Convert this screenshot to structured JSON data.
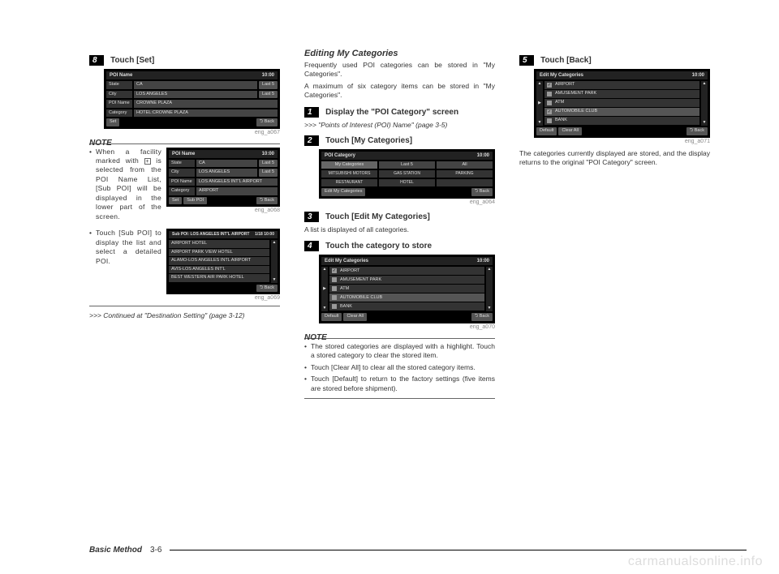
{
  "col1": {
    "step8": {
      "num": "8",
      "title": "Touch [Set]"
    },
    "screen1": {
      "title": "POI Name",
      "time": "10:00",
      "rows": [
        {
          "label": "State",
          "value": "CA",
          "btn": "Last 5"
        },
        {
          "label": "City",
          "value": "LOS ANGELES",
          "btn": "Last 5"
        },
        {
          "label": "POI Name",
          "value": "CROWNE PLAZA",
          "btn": ""
        },
        {
          "label": "Category",
          "value": "HOTEL:CROWNE PLAZA",
          "btn": ""
        }
      ],
      "set": "Set",
      "back": "Back",
      "caption": "eng_a067"
    },
    "note_label": "NOTE",
    "note1": {
      "text": "When a facility marked with       is selected from the POI Name List, [Sub POI] will be displayed in the lower part of the screen.",
      "plus": "+",
      "screen": {
        "title": "POI Name",
        "time": "10:00",
        "rows": [
          {
            "label": "State",
            "value": "CA",
            "btn": "Last 5"
          },
          {
            "label": "City",
            "value": "LOS ANGELES",
            "btn": "Last 5"
          },
          {
            "label": "POI Name",
            "value": "LOS ANGELES INT'L AIRPORT",
            "btn": ""
          },
          {
            "label": "Category",
            "value": "AIRPORT",
            "btn": ""
          }
        ],
        "set": "Set",
        "sub": "Sub POI",
        "back": "Back",
        "caption": "eng_a068"
      }
    },
    "note2": {
      "text": "Touch [Sub POI] to display the list and select a detailed POI.",
      "screen": {
        "title": "Sub POI: LOS ANGELES INT'L AIRPORT",
        "count": "1/18",
        "time": "10:00",
        "items": [
          "AIRPORT HOTEL",
          "AIRPORT PARK VIEW HOTEL",
          "ALAMO-LOS ANGELES INTL AIRPORT",
          "AVIS-LOS ANGELES INT'L",
          "BEST WESTERN AIR PARK HOTEL"
        ],
        "back": "Back",
        "caption": "eng_a069"
      }
    },
    "continued": ">>> Continued at \"Destination Setting\" (page 3-12)"
  },
  "col2": {
    "heading": "Editing My Categories",
    "para1": "Frequently used POI categories can be stored in \"My Categories\".",
    "para2": "A maximum of six category items can be stored in \"My Categories\".",
    "step1": {
      "num": "1",
      "title": "Display the \"POI Category\" screen"
    },
    "ref1": ">>> \"Points of Interest (POI) Name\" (page 3-5)",
    "step2": {
      "num": "2",
      "title": "Touch [My Categories]"
    },
    "screen2": {
      "title": "POI Category",
      "time": "10:00",
      "tabs": [
        "My Categories",
        "Last 5",
        "All"
      ],
      "grid": [
        "MITSUBISHI MOTORS",
        "GAS STATION",
        "PARKING",
        "RESTAURANT",
        "HOTEL",
        ""
      ],
      "edit": "Edit My Categories",
      "back": "Back",
      "caption": "eng_a064"
    },
    "step3": {
      "num": "3",
      "title": "Touch [Edit My Categories]"
    },
    "step3_body": "A list is displayed of all categories.",
    "step4": {
      "num": "4",
      "title": "Touch the category to store"
    },
    "screen4": {
      "title": "Edit My Categories",
      "time": "10:00",
      "items": [
        {
          "chk": true,
          "label": "AIRPORT"
        },
        {
          "chk": false,
          "label": "AMUSEMENT PARK"
        },
        {
          "chk": false,
          "label": "ATM"
        },
        {
          "chk": false,
          "label": "AUTOMOBILE CLUB",
          "hl": true
        },
        {
          "chk": false,
          "label": "BANK"
        }
      ],
      "default": "Default",
      "clear": "Clear All",
      "back": "Back",
      "caption": "eng_a070"
    },
    "note_label": "NOTE",
    "notes": [
      "The stored categories are displayed with a highlight. Touch a stored category to clear the stored item.",
      "Touch [Clear All] to clear all the stored category items.",
      "Touch [Default] to return to the factory settings (five items are stored before shipment)."
    ]
  },
  "col3": {
    "step5": {
      "num": "5",
      "title": "Touch [Back]"
    },
    "screen5": {
      "title": "Edit My Categories",
      "time": "10:00",
      "items": [
        {
          "chk": true,
          "label": "AIRPORT"
        },
        {
          "chk": false,
          "label": "AMUSEMENT PARK"
        },
        {
          "chk": false,
          "label": "ATM"
        },
        {
          "chk": true,
          "label": "AUTOMOBILE CLUB",
          "hl": true
        },
        {
          "chk": false,
          "label": "BANK"
        }
      ],
      "default": "Default",
      "clear": "Clear All",
      "back": "Back",
      "caption": "eng_a071"
    },
    "para": "The categories currently displayed are stored, and the display returns to the original \"POI Category\" screen."
  },
  "footer": {
    "section": "Basic Method",
    "page": "3-6"
  },
  "watermark": "carmanualsonline.info"
}
